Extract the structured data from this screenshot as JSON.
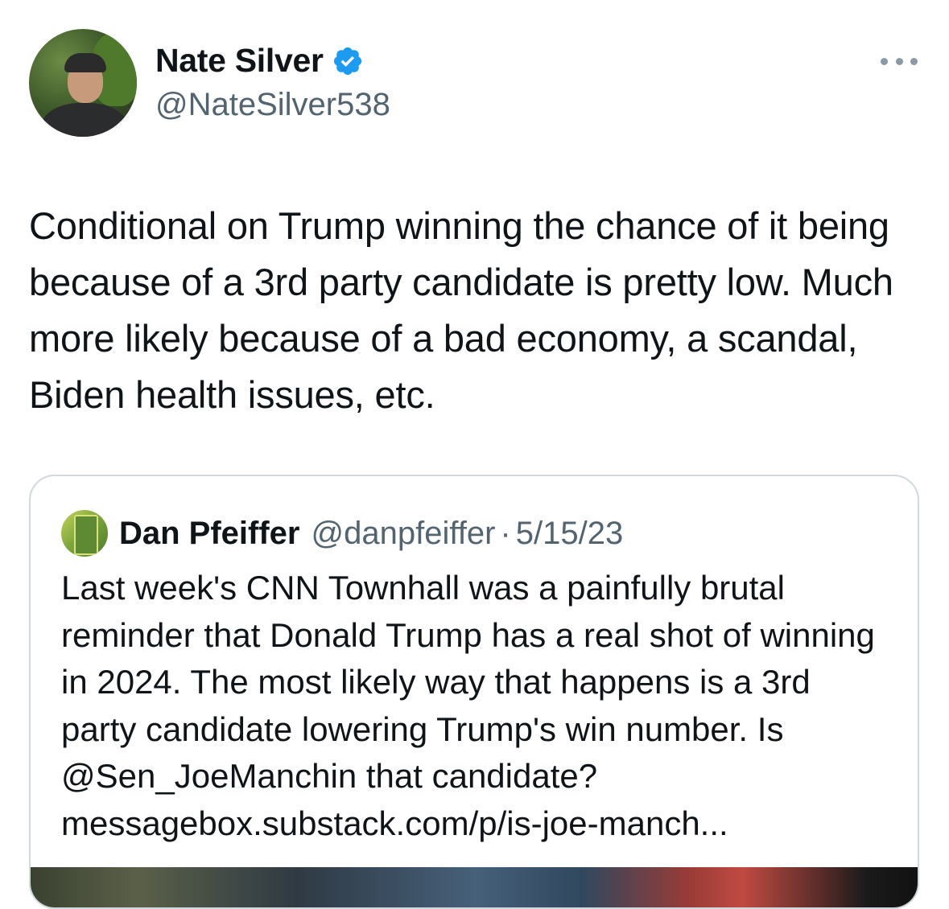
{
  "tweet": {
    "author": {
      "display_name": "Nate Silver",
      "handle": "@NateSilver538",
      "verified": true,
      "avatar_icon": "profile-photo-icon"
    },
    "text": "Conditional on Trump winning the chance of it being because of a 3rd party candidate is pretty low. Much more likely because of a bad economy, a scandal, Biden health issues, etc.",
    "more_icon": "more-options-icon"
  },
  "quote": {
    "author": {
      "display_name": "Dan Pfeiffer",
      "handle": "@danpfeiffer",
      "separator": "·",
      "date": "5/15/23",
      "avatar_icon": "book-cover-avatar-icon"
    },
    "text": "Last week's CNN Townhall was a painfully brutal reminder that Donald Trump has a real shot of winning in 2024. The most likely way that happens is a 3rd party candidate lowering Trump's win number. Is @Sen_JoeManchin that candidate? messagebox.substack.com/p/is-joe-manch..."
  },
  "colors": {
    "text_primary": "#0f1419",
    "text_secondary": "#536471",
    "verified_blue": "#1d9bf0",
    "border": "#cfd9de"
  }
}
